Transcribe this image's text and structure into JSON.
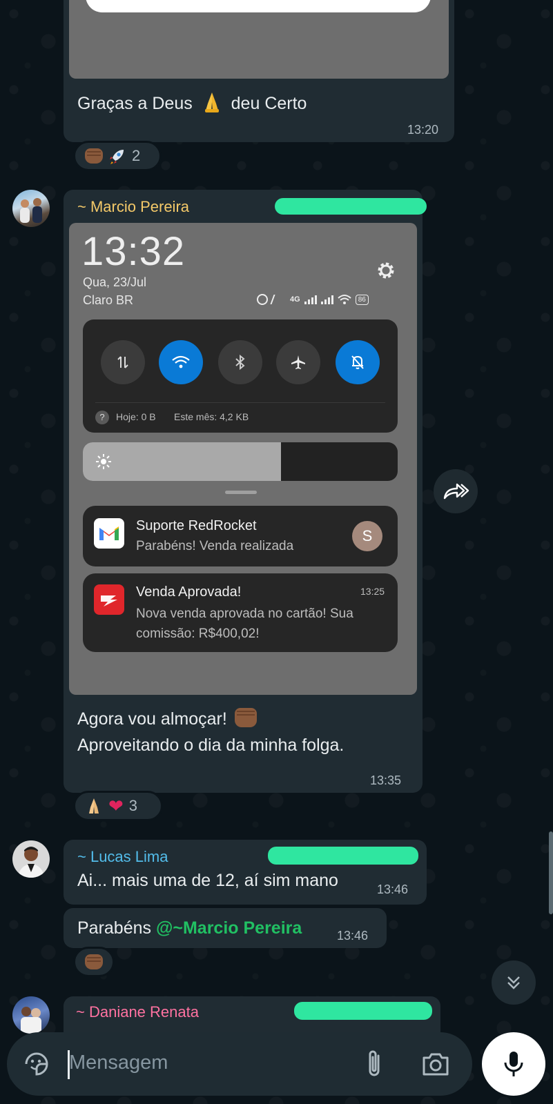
{
  "colors": {
    "background": "#0b141a",
    "bubble": "#202c33",
    "accent_green": "#00a884",
    "sender_marcio": "#f4c969",
    "sender_lucas": "#53bdeb",
    "sender_daniane": "#ff72a1",
    "mention": "#21c063",
    "redaction": "#2fe6a0"
  },
  "messages": [
    {
      "text_before": "Graças a Deus",
      "emoji": "folded-hands",
      "text_after": "deu Certo",
      "time": "13:20",
      "reactions": [
        "fist-bump",
        "rocket"
      ],
      "reaction_count": "2"
    },
    {
      "sender": "~ Marcio Pereira",
      "has_image": true,
      "line1": "Agora vou almoçar!",
      "line1_emoji": "fist-bump",
      "line2": "Aproveitando o dia da minha folga.",
      "time": "13:35",
      "reactions": [
        "folded-hands",
        "red-heart"
      ],
      "reaction_count": "3"
    },
    {
      "sender": "~ Lucas Lima",
      "text": "Ai... mais uma de 12, aí sim mano",
      "time": "13:46"
    },
    {
      "text": "Parabéns",
      "mention": "@~Marcio Pereira",
      "time": "13:46",
      "reactions": [
        "fist-bump"
      ]
    },
    {
      "sender": "~ Daniane Renata"
    }
  ],
  "screenshot": {
    "clock": "13:32",
    "date": "Qua, 23/Jul",
    "carrier": "Claro BR",
    "battery": "86",
    "network": "4G",
    "data_today": "Hoje: 0 B",
    "data_month": "Este mês: 4,2 KB",
    "brightness_level": 0.63,
    "toggles": [
      {
        "name": "mobile-data",
        "on": false
      },
      {
        "name": "wifi",
        "on": true
      },
      {
        "name": "bluetooth",
        "on": false
      },
      {
        "name": "airplane-mode",
        "on": false
      },
      {
        "name": "do-not-disturb",
        "on": true
      }
    ],
    "notifications": [
      {
        "app": "Gmail",
        "title": "Suporte RedRocket",
        "body": "Parabéns! Venda realizada",
        "avatar_letter": "S",
        "time": ""
      },
      {
        "app": "RedRocket",
        "title": "Venda Aprovada!",
        "body_line1": "Nova venda aprovada no cartão! Sua",
        "body_line2": "comissão: R$400,02!",
        "time": "13:25"
      }
    ]
  },
  "composer": {
    "placeholder": "Mensagem"
  }
}
